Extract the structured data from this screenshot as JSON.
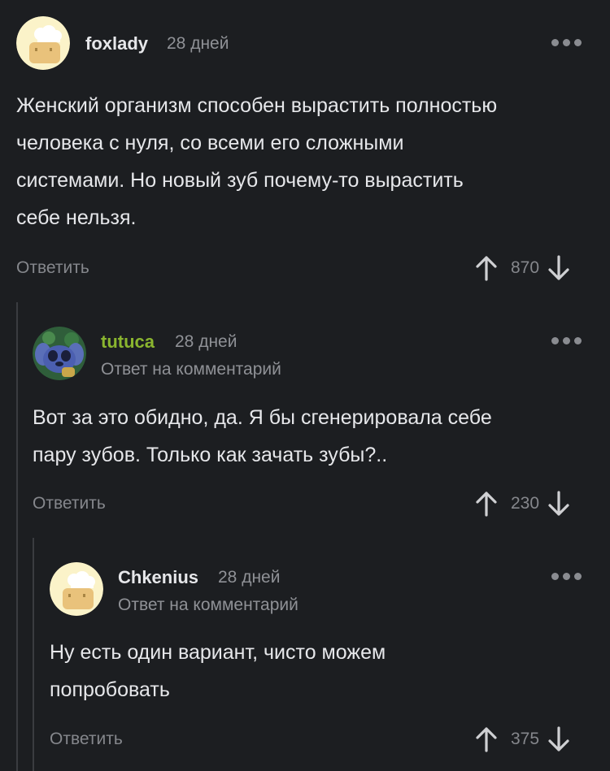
{
  "colors": {
    "background": "#1c1e21",
    "text": "#e6e7ea",
    "muted": "#8f9196",
    "username_default": "#e6e7ea",
    "username_accent": "#8ab52f",
    "thread_line": "#3a3c40"
  },
  "comments": [
    {
      "username": "foxlady",
      "time": "28 дней",
      "reply_to": "",
      "text_lines": [
        "Женский организм способен вырастить полностью",
        "человека с нуля, со всеми его сложными",
        "системами. Но новый зуб почему-то вырастить",
        "себе нельзя."
      ],
      "reply_label": "Ответить",
      "score": "870",
      "avatar": "default-chef-avatar"
    },
    {
      "username": "tutuca",
      "time": "28 дней",
      "reply_to": "Ответ на комментарий",
      "text_lines": [
        "Вот за это обидно, да. Я бы сгенерировала себе",
        "пару зубов. Только как зачать зубы?.."
      ],
      "reply_label": "Ответить",
      "score": "230",
      "avatar": "stitch-character-avatar"
    },
    {
      "username": "Chkenius",
      "time": "28 дней",
      "reply_to": "Ответ на комментарий",
      "text_lines": [
        "Ну есть один вариант, чисто можем",
        "попробовать"
      ],
      "reply_label": "Ответить",
      "score": "375",
      "avatar": "default-chef-avatar"
    }
  ]
}
